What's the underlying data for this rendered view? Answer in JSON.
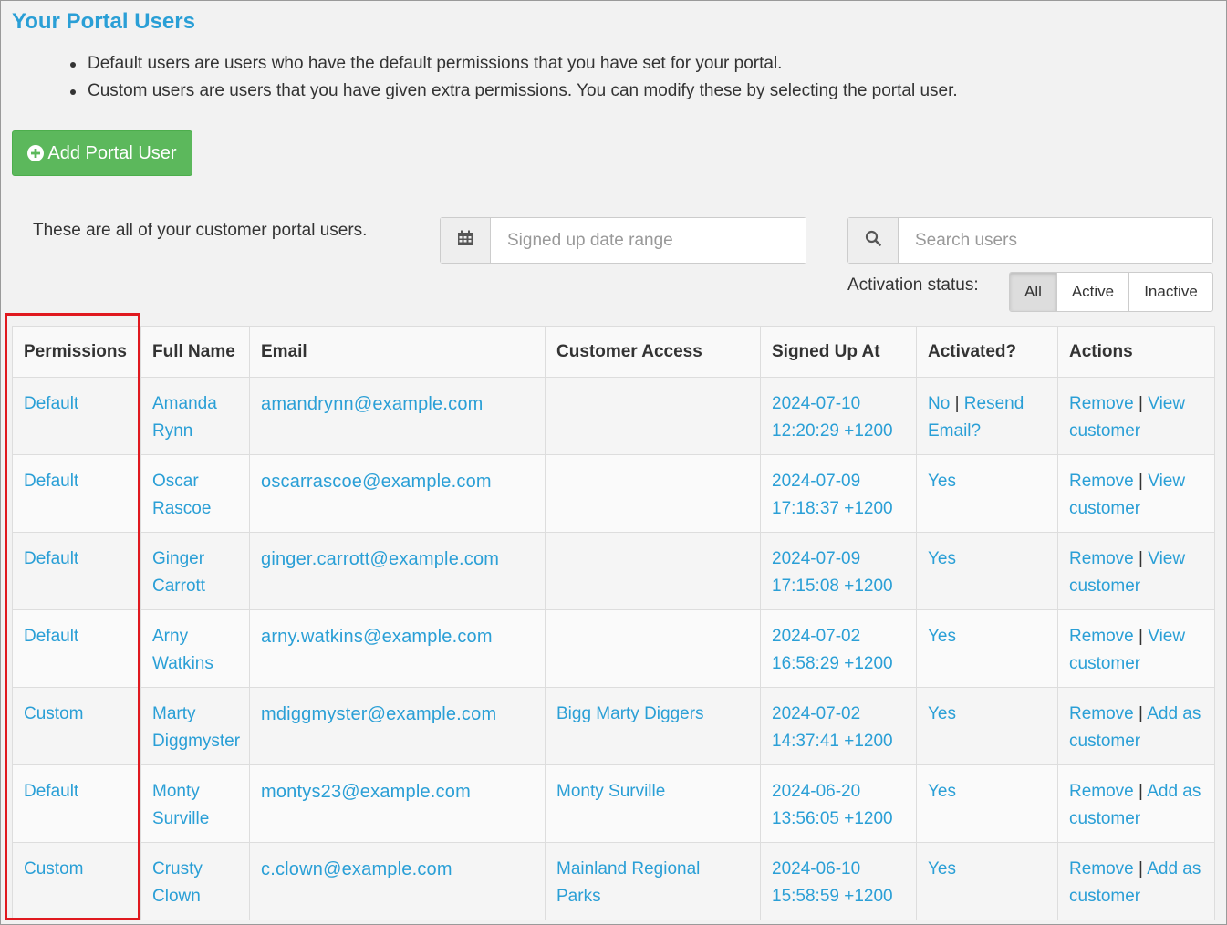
{
  "page": {
    "title": "Your Portal Users",
    "bullets": [
      "Default users are users who have the default permissions that you have set for your portal.",
      "Custom users are users that you have given extra permissions. You can modify these by selecting the portal user."
    ]
  },
  "add_button": {
    "label": "Add Portal User",
    "icon": "plus-circle-icon",
    "color": "#5cb85c"
  },
  "intro_text": "These are all of your customer portal users.",
  "date_filter": {
    "placeholder": "Signed up date range",
    "icon": "calendar-icon"
  },
  "search": {
    "placeholder": "Search users",
    "icon": "search-icon"
  },
  "activation": {
    "label": "Activation status:",
    "options": [
      "All",
      "Active",
      "Inactive"
    ],
    "selected": "All"
  },
  "table": {
    "headers": [
      "Permissions",
      "Full Name",
      "Email",
      "Customer Access",
      "Signed Up At",
      "Activated?",
      "Actions"
    ],
    "rows": [
      {
        "permissions": "Default",
        "name": "Amanda Rynn",
        "email": "amandrynn@example.com",
        "access": "",
        "signed_date": "2024-07-10",
        "signed_time": "12:20:29 +1200",
        "activated": "No",
        "resend": "Resend Email?",
        "remove": "Remove",
        "action2": "View customer"
      },
      {
        "permissions": "Default",
        "name": "Oscar Rascoe",
        "email": "oscarrascoe@example.com",
        "access": "",
        "signed_date": "2024-07-09",
        "signed_time": "17:18:37 +1200",
        "activated": "Yes",
        "resend": "",
        "remove": "Remove",
        "action2": "View customer"
      },
      {
        "permissions": "Default",
        "name": "Ginger Carrott",
        "email": "ginger.carrott@example.com",
        "access": "",
        "signed_date": "2024-07-09",
        "signed_time": "17:15:08 +1200",
        "activated": "Yes",
        "resend": "",
        "remove": "Remove",
        "action2": "View customer"
      },
      {
        "permissions": "Default",
        "name": "Arny Watkins",
        "email": "arny.watkins@example.com",
        "access": "",
        "signed_date": "2024-07-02",
        "signed_time": "16:58:29 +1200",
        "activated": "Yes",
        "resend": "",
        "remove": "Remove",
        "action2": "View customer"
      },
      {
        "permissions": "Custom",
        "name": "Marty Diggmyster",
        "email": "mdiggmyster@example.com",
        "access": "Bigg Marty Diggers",
        "signed_date": "2024-07-02",
        "signed_time": "14:37:41 +1200",
        "activated": "Yes",
        "resend": "",
        "remove": "Remove",
        "action2": "Add as customer"
      },
      {
        "permissions": "Default",
        "name": "Monty Surville",
        "email": "montys23@example.com",
        "access": "Monty Surville",
        "signed_date": "2024-06-20",
        "signed_time": "13:56:05 +1200",
        "activated": "Yes",
        "resend": "",
        "remove": "Remove",
        "action2": "Add as customer"
      },
      {
        "permissions": "Custom",
        "name": "Crusty Clown",
        "email": "c.clown@example.com",
        "access": "Mainland Regional Parks",
        "signed_date": "2024-06-10",
        "signed_time": "15:58:59 +1200",
        "activated": "Yes",
        "resend": "",
        "remove": "Remove",
        "action2": "Add as customer"
      }
    ]
  },
  "colors": {
    "link": "#2a9fd6",
    "title": "#2a9fd6",
    "highlight": "#e0191f"
  }
}
